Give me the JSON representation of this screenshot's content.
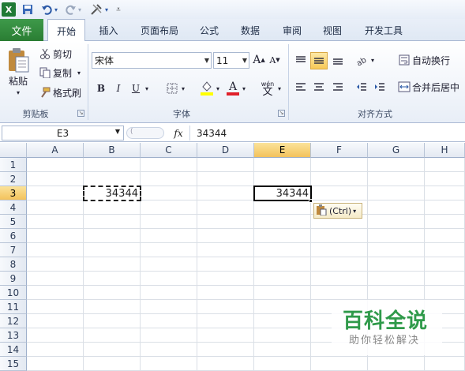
{
  "quick_access": {
    "icons": [
      "excel-logo-icon",
      "save-icon",
      "undo-icon",
      "redo-icon",
      "customize-icon"
    ]
  },
  "tabs": [
    "文件",
    "开始",
    "插入",
    "页面布局",
    "公式",
    "数据",
    "审阅",
    "视图",
    "开发工具"
  ],
  "ribbon": {
    "clipboard": {
      "paste": "粘贴",
      "cut": "剪切",
      "copy": "复制",
      "format_painter": "格式刷",
      "group": "剪贴板"
    },
    "font": {
      "name": "宋体",
      "size": "11",
      "bold": "B",
      "italic": "I",
      "underline": "U",
      "grow": "A",
      "shrink": "A",
      "phonetic": "wén",
      "phonetic_char": "文",
      "group": "字体"
    },
    "alignment": {
      "wrap": "自动换行",
      "merge": "合并后居中",
      "group": "对齐方式"
    }
  },
  "formula_bar": {
    "name_box": "E3",
    "fx": "fx",
    "value": "34344"
  },
  "grid": {
    "columns": [
      "A",
      "B",
      "C",
      "D",
      "E",
      "F",
      "G",
      "H"
    ],
    "rows": [
      "1",
      "2",
      "3",
      "4",
      "5",
      "6",
      "7",
      "8",
      "9",
      "10",
      "11",
      "12",
      "13",
      "14",
      "15"
    ],
    "selected_column": "E",
    "selected_row": "3",
    "cell_b3": "34344",
    "cell_e3": "34344",
    "paste_options": "(Ctrl)"
  },
  "watermark": {
    "title": "百科全说",
    "subtitle": "助你轻松解决"
  },
  "colors": {
    "file_tab": "#2a7d33",
    "selection_header": "#f3c25c",
    "font_color_bar": "#e0202a",
    "fill_color_bar": "#ffff00"
  }
}
